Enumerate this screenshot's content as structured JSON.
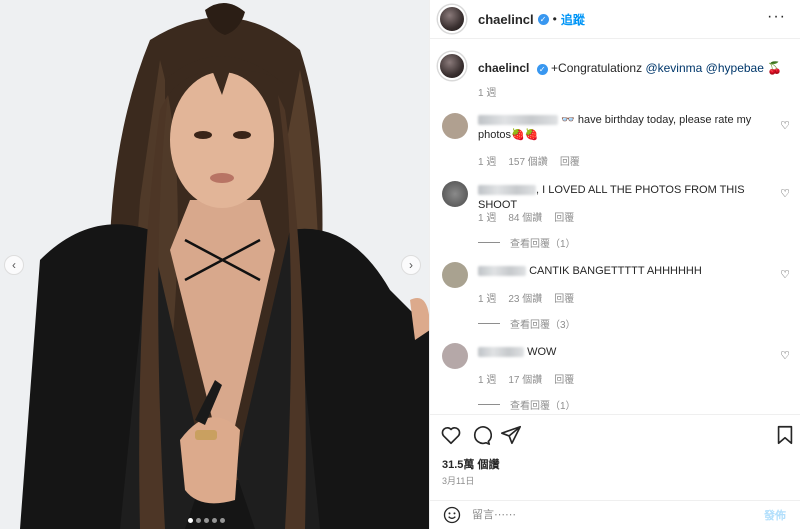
{
  "post": {
    "username": "chaelincl",
    "follow_label": "追蹤",
    "header_sep": "•",
    "more_glyph": "···",
    "verified_glyph": "✓",
    "photo_prev": "‹",
    "photo_next": "›"
  },
  "caption": {
    "username": "chaelincl",
    "text": "+Congratulationz",
    "mention1": "@kevinma",
    "mention2": "@hypebae",
    "emoji": "🍒",
    "time": "1 週"
  },
  "comments": [
    {
      "text": "have birthday today, please rate my",
      "text2": "photos",
      "emoji": "🍓🍓",
      "prefix_emoji": "👓",
      "time": "1 週",
      "likes": "157 個讚",
      "reply": "回覆",
      "avatar_color": "#b0a090"
    },
    {
      "text": ", I LOVED ALL THE PHOTOS FROM THIS SHOOT",
      "time": "1 週",
      "likes": "84 個讚",
      "reply": "回覆",
      "view_replies": "查看回覆（1）",
      "avatar_color": "#6a6a6a"
    },
    {
      "text": "CANTIK BANGETTTTT AHHHHHH",
      "time": "1 週",
      "likes": "23 個讚",
      "reply": "回覆",
      "view_replies": "查看回覆（3）",
      "avatar_color": "#a9a290"
    },
    {
      "text": "WOW",
      "time": "1 週",
      "likes": "17 個讚",
      "reply": "回覆",
      "view_replies": "查看回覆（1）",
      "avatar_color": "#b5a8a8"
    }
  ],
  "actions": {
    "like_icon": "heart-outline",
    "comment_icon": "speech-bubble",
    "share_icon": "paper-plane",
    "save_icon": "bookmark"
  },
  "likes_total": "31.5萬 個讚",
  "date": "3月11日",
  "comment_box": {
    "placeholder": "留言⋯⋯",
    "post_label": "發佈"
  },
  "colors": {
    "accent": "#0095f6",
    "text": "#262626",
    "muted": "#8e8e8e",
    "verified": "#3897f0"
  }
}
